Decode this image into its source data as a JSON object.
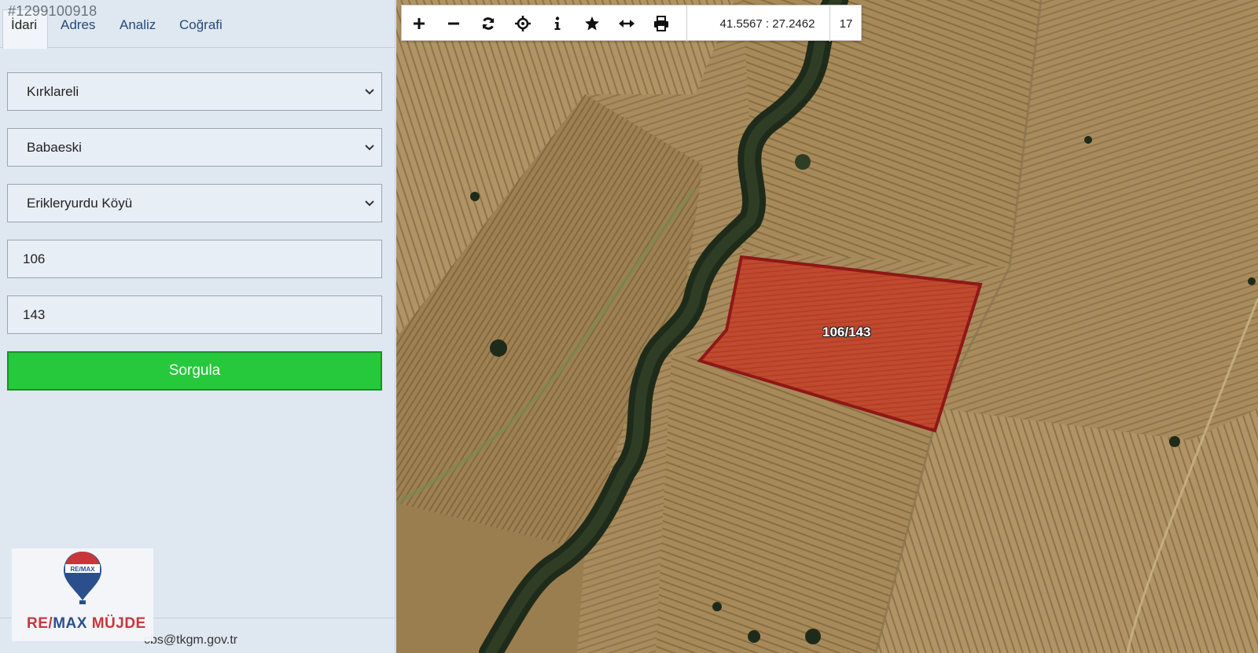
{
  "listing_id": "#1299100918",
  "tabs": [
    {
      "label": "İdari"
    },
    {
      "label": "Adres"
    },
    {
      "label": "Analiz"
    },
    {
      "label": "Coğrafi"
    }
  ],
  "form": {
    "province": "Kırklareli",
    "district": "Babaeski",
    "neighborhood": "Erikleryurdu Köyü",
    "block_no": "106",
    "parcel_no": "143",
    "query_button": "Sorgula"
  },
  "footer": {
    "email": "cbs@tkgm.gov.tr"
  },
  "logo": {
    "balloon_text": "RE/MAX",
    "brand_red": "RE/",
    "brand_blue": "MAX",
    "brand_rest": " MÜJDE"
  },
  "toolbar": {
    "tools": [
      "zoom-in-icon",
      "zoom-out-icon",
      "refresh-icon",
      "locate-icon",
      "info-icon",
      "favorite-icon",
      "measure-icon",
      "print-icon"
    ],
    "coordinates": "41.5567 : 27.2462",
    "zoom_level": "17"
  },
  "map": {
    "parcel_label": "106/143",
    "parcel_fill": "#c23a22",
    "parcel_border": "#8e0f12"
  },
  "colors": {
    "sidebar_bg": "#dfe8f1",
    "button_green": "#26c93b",
    "tab_text": "#24497a"
  }
}
